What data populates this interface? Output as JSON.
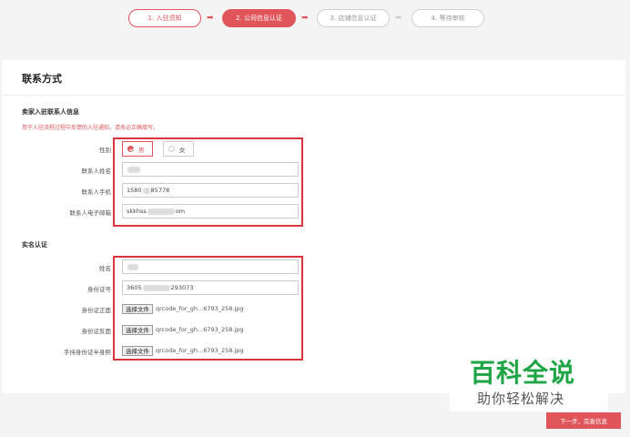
{
  "steps": [
    {
      "label": "1. 入驻须知",
      "state": "done"
    },
    {
      "label": "2. 公司信息认证",
      "state": "active"
    },
    {
      "label": "3. 店铺信息认证",
      "state": "pending"
    },
    {
      "label": "4. 等待审核",
      "state": "pending"
    }
  ],
  "card": {
    "title": "联系方式",
    "contact_section": {
      "title": "卖家入驻联系人信息",
      "notice": "用于入驻流程过程中反馈的入驻通知，请务必正确填写。",
      "gender_label": "性别",
      "gender_options": [
        "男",
        "女"
      ],
      "gender_selected": "男",
      "name_label": "联系人姓名",
      "name_value": "",
      "phone_label": "联系人手机",
      "phone_prefix": "1580",
      "phone_suffix": "85778",
      "email_label": "联系人电子邮箱",
      "email_prefix": "skkhss",
      "email_suffix": "om"
    },
    "realname_section": {
      "title": "实名认证",
      "name_label": "姓名",
      "name_value": "",
      "id_label": "身份证号",
      "id_prefix": "3605",
      "id_suffix": "293073",
      "front_label": "身份证正面",
      "back_label": "身份证反面",
      "hand_label": "手持身份证半身照",
      "file_button": "选择文件",
      "file_name": "qrcode_for_gh...6793_258.jpg"
    }
  },
  "watermark": {
    "big": "百科全说",
    "small": "助你轻松解决"
  },
  "next_button": "下一步，完善信息",
  "colors": {
    "accent": "#e0555a",
    "highlight": "#d9363e",
    "watermark": "#1fa446"
  }
}
